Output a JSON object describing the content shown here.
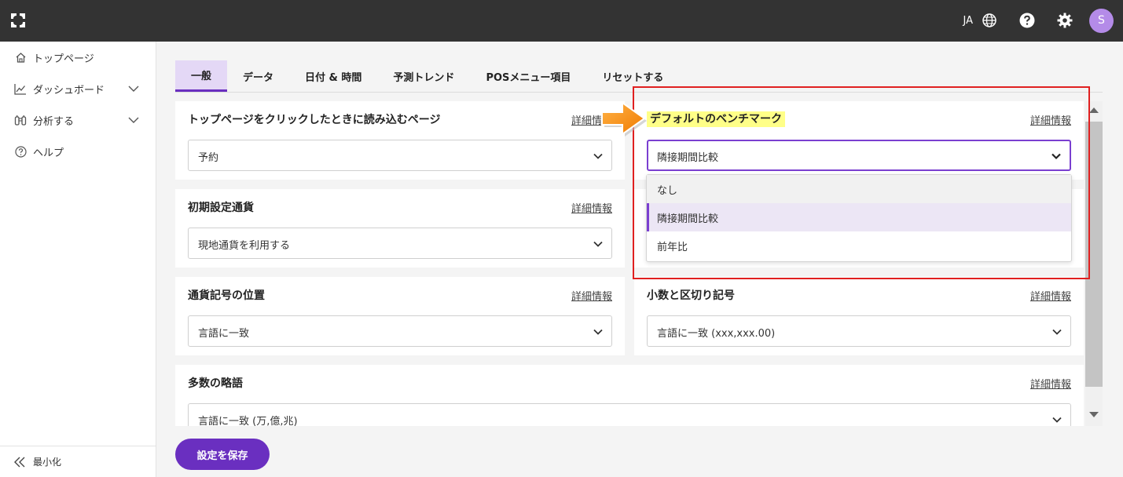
{
  "topbar": {
    "lang_label": "JA",
    "avatar_initial": "S"
  },
  "sidebar": {
    "items": [
      {
        "label": "トップページ"
      },
      {
        "label": "ダッシュボード"
      },
      {
        "label": "分析する"
      },
      {
        "label": "ヘルプ"
      }
    ],
    "minimize_label": "最小化"
  },
  "tabs": [
    {
      "label": "一般"
    },
    {
      "label": "データ"
    },
    {
      "label": "日付 & 時間"
    },
    {
      "label": "予測トレンド"
    },
    {
      "label": "POSメニュー項目"
    },
    {
      "label": "リセットする"
    }
  ],
  "detail_label": "詳細情報",
  "cards": {
    "top_page": {
      "title": "トップページをクリックしたときに読み込むページ",
      "value": "予約"
    },
    "benchmark": {
      "title": "デフォルトのベンチマーク",
      "value": "隣接期間比較"
    },
    "currency": {
      "title": "初期設定通貨",
      "value": "現地通貨を利用する"
    },
    "symbol_position": {
      "title": "通貨記号の位置",
      "value": "言語に一致"
    },
    "decimal": {
      "title": "小数と区切り記号",
      "value": "言語に一致 (xxx,xxx.00)"
    },
    "abbrev": {
      "title": "多数の略語",
      "value": "言語に一致 (万,億,兆)"
    }
  },
  "dropdown_options": [
    {
      "label": "なし"
    },
    {
      "label": "隣接期間比較"
    },
    {
      "label": "前年比"
    }
  ],
  "save_label": "設定を保存",
  "colors": {
    "accent": "#6a2fc0",
    "topbar": "#333333",
    "highlight": "#ffff88",
    "annotation": "#e02020"
  }
}
